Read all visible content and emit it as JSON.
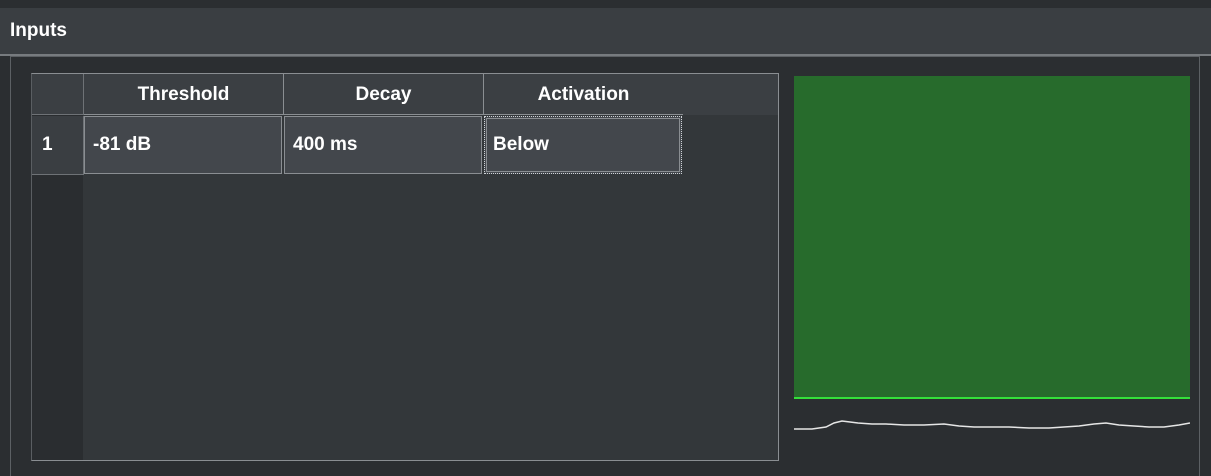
{
  "panel": {
    "title": "Inputs"
  },
  "table": {
    "columns": [
      "Threshold",
      "Decay",
      "Activation"
    ],
    "rows": [
      {
        "index": "1",
        "threshold": "-81 dB",
        "decay": "400 ms",
        "activation": "Below"
      }
    ]
  },
  "meter": {
    "level_fraction": 0.0,
    "fill_color": "#276b2c",
    "line_color": "#34e03a",
    "waveform_color": "#ffffff"
  },
  "colors": {
    "background": "#2b2e31",
    "header_bg": "#3b3f43",
    "cell_bg": "#43474c"
  }
}
